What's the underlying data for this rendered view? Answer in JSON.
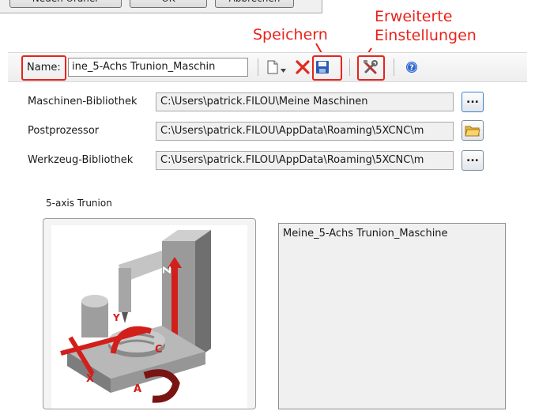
{
  "dialog_top": {
    "new_folder_button": "Neuen Ordner erstellen",
    "ok_button": "OK",
    "cancel_button": "Abbrechen"
  },
  "annotations": {
    "save": "Speichern",
    "advanced_line1": "Erweiterte",
    "advanced_line2": "Einstellungen",
    "color": "#e8231c"
  },
  "toolbar": {
    "name_label": "Name:",
    "name_value": "ine_5-Achs Trunion_Maschin",
    "icons": [
      "new-document-icon",
      "dropdown-arrow-icon",
      "delete-icon",
      "save-icon",
      "settings-tools-icon",
      "help-icon"
    ]
  },
  "form": {
    "machine_library_label": "Maschinen-Bibliothek",
    "machine_library_value": "C:\\Users\\patrick.FILOU\\Meine Maschinen",
    "postprocessor_label": "Postprozessor",
    "postprocessor_value": "C:\\Users\\patrick.FILOU\\AppData\\Roaming\\5XCNC\\m",
    "tool_library_label": "Werkzeug-Bibliothek",
    "tool_library_value": "C:\\Users\\patrick.FILOU\\AppData\\Roaming\\5XCNC\\m",
    "browse_label": "..."
  },
  "machine": {
    "type_label": "5-axis Trunion",
    "list_items": [
      "Meine_5-Achs Trunion_Maschine"
    ],
    "axis_labels": [
      "Z",
      "Y",
      "X",
      "C",
      "A"
    ]
  }
}
